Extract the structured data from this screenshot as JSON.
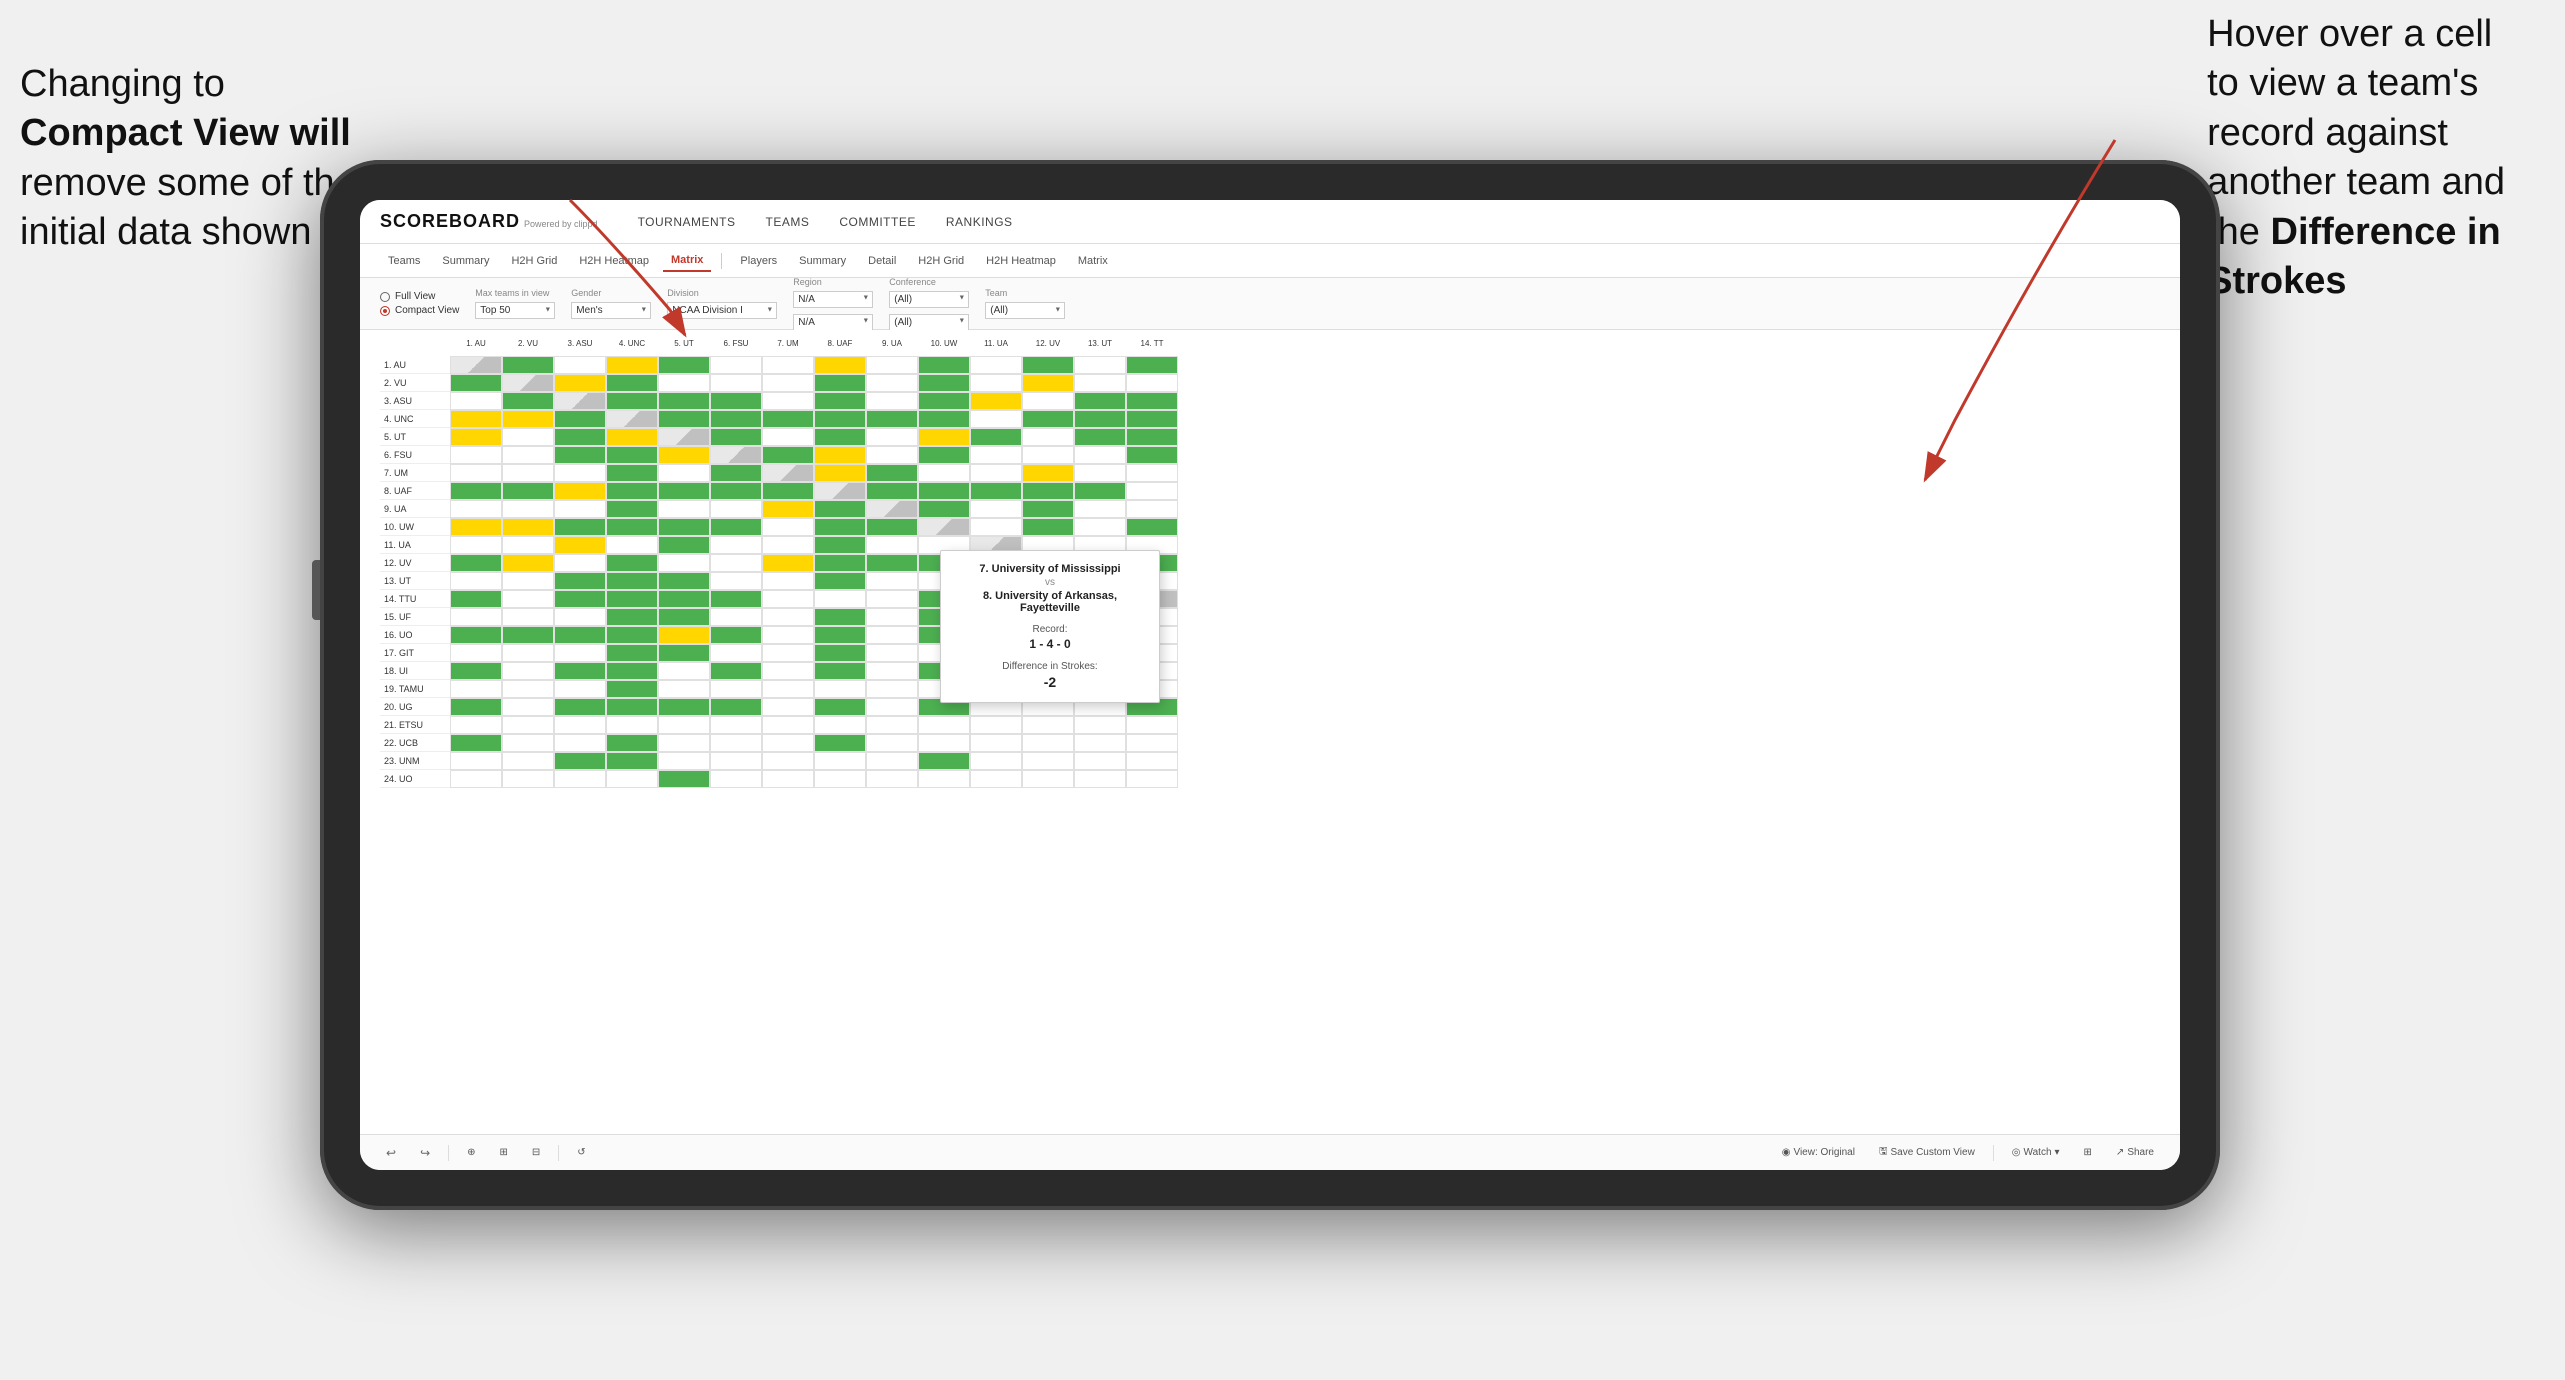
{
  "annotations": {
    "left": {
      "line1": "Changing to",
      "line2": "Compact View will",
      "line3": "remove some of the",
      "line4": "initial data shown"
    },
    "right": {
      "line1": "Hover over a cell",
      "line2": "to view a team's",
      "line3": "record against",
      "line4": "another team and",
      "line5": "the ",
      "line5b": "Difference in",
      "line6": "Strokes"
    }
  },
  "app": {
    "logo": "SCOREBOARD",
    "logo_sub": "Powered by clippd",
    "nav": [
      "TOURNAMENTS",
      "TEAMS",
      "COMMITTEE",
      "RANKINGS"
    ]
  },
  "subnav": {
    "group1": [
      "Teams",
      "Summary",
      "H2H Grid",
      "H2H Heatmap",
      "Matrix"
    ],
    "group2": [
      "Players",
      "Summary",
      "Detail",
      "H2H Grid",
      "H2H Heatmap",
      "Matrix"
    ],
    "active": "Matrix"
  },
  "controls": {
    "view_options": [
      "Full View",
      "Compact View"
    ],
    "selected_view": "Compact View",
    "max_teams_label": "Max teams in view",
    "max_teams_value": "Top 50",
    "gender_label": "Gender",
    "gender_value": "Men's",
    "division_label": "Division",
    "division_value": "NCAA Division I",
    "region_label": "Region",
    "region_value": "N/A",
    "conference_label": "Conference",
    "conference_value": "(All)",
    "team_label": "Team",
    "team_value": "(All)"
  },
  "col_headers": [
    "1. AU",
    "2. VU",
    "3. ASU",
    "4. UNC",
    "5. UT",
    "6. FSU",
    "7. UM",
    "8. UAF",
    "9. UA",
    "10. UW",
    "11. UA",
    "12. UV",
    "13. UT",
    "14. TT"
  ],
  "row_labels": [
    "1. AU",
    "2. VU",
    "3. ASU",
    "4. UNC",
    "5. UT",
    "6. FSU",
    "7. UM",
    "8. UAF",
    "9. UA",
    "10. UW",
    "11. UA",
    "12. UV",
    "13. UT",
    "14. TTU",
    "15. UF",
    "16. UO",
    "17. GIT",
    "18. UI",
    "19. TAMU",
    "20. UG",
    "21. ETSU",
    "22. UCB",
    "23. UNM",
    "24. UO"
  ],
  "tooltip": {
    "team1": "7. University of Mississippi",
    "vs": "vs",
    "team2": "8. University of Arkansas, Fayetteville",
    "record_label": "Record:",
    "record_value": "1 - 4 - 0",
    "strokes_label": "Difference in Strokes:",
    "strokes_value": "-2"
  },
  "toolbar": {
    "undo_label": "↩",
    "redo_label": "↪",
    "view_original": "View: Original",
    "save_custom": "Save Custom View",
    "watch": "Watch",
    "share": "Share"
  }
}
